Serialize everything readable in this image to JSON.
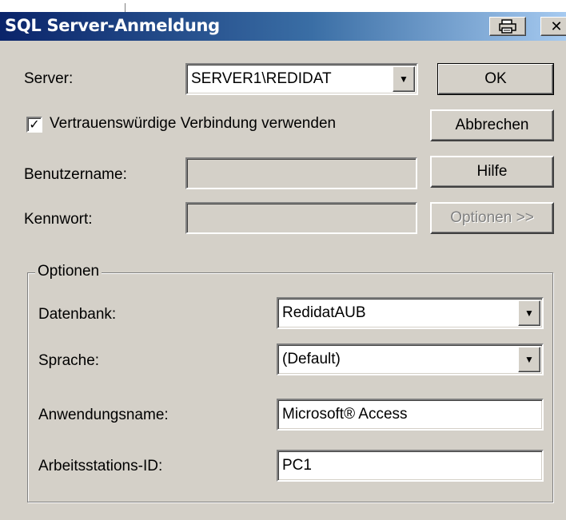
{
  "window": {
    "title": "SQL Server-Anmeldung",
    "close_glyph": "✕",
    "print_icon": "printer-icon"
  },
  "server": {
    "label": "Server:",
    "value": "SERVER1\\REDIDAT"
  },
  "trusted_connection": {
    "label": "Vertrauenswürdige Verbindung verwenden",
    "checked": true
  },
  "username": {
    "label": "Benutzername:",
    "value": ""
  },
  "password": {
    "label": "Kennwort:",
    "value": ""
  },
  "buttons": {
    "ok": "OK",
    "cancel": "Abbrechen",
    "help": "Hilfe",
    "options": "Optionen >>"
  },
  "options": {
    "legend": "Optionen",
    "database": {
      "label": "Datenbank:",
      "value": "RedidatAUB"
    },
    "language": {
      "label": "Sprache:",
      "value": "(Default)"
    },
    "app_name": {
      "label": "Anwendungsname:",
      "value": "Microsoft® Access"
    },
    "workstation_id": {
      "label": "Arbeitsstations-ID:",
      "value": "PC1"
    }
  },
  "colors": {
    "window_bg": "#d4d0c8",
    "title_start": "#0a246a",
    "title_end": "#a6caf0"
  }
}
